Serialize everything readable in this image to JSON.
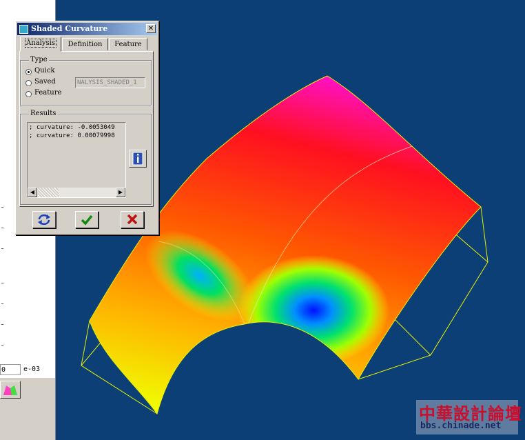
{
  "viewport": {
    "background_color": "#0d3f77",
    "model_colormap": [
      "#ff00ff",
      "#ff0000",
      "#ff6a00",
      "#ffaa00",
      "#ffff00",
      "#00ff80",
      "#0080ff",
      "#0000ff"
    ]
  },
  "left_panel": {
    "field_a": "0",
    "field_b": "e-03"
  },
  "dialog": {
    "title": "Shaded Curvature",
    "close_glyph": "✕",
    "tabs": {
      "analysis": "Analysis",
      "definition": "Definition",
      "feature": "Feature"
    },
    "type_group": {
      "label": "Type",
      "options": {
        "quick": "Quick",
        "saved": "Saved",
        "feature": "Feature"
      },
      "selected": "Quick",
      "saved_name": "NALYSIS_SHADED_1"
    },
    "results_group": {
      "label": "Results",
      "lines": [
        "; curvature:  -0.0053049",
        "; curvature:  0.00079998"
      ]
    },
    "buttons": {
      "repaint_icon": "repaint-icon",
      "ok_icon": "checkmark-icon",
      "cancel_icon": "cross-icon",
      "info_icon": "info-icon"
    }
  },
  "watermark": {
    "chinese": "中華設計論壇",
    "url": "bbs.chinade.net"
  }
}
